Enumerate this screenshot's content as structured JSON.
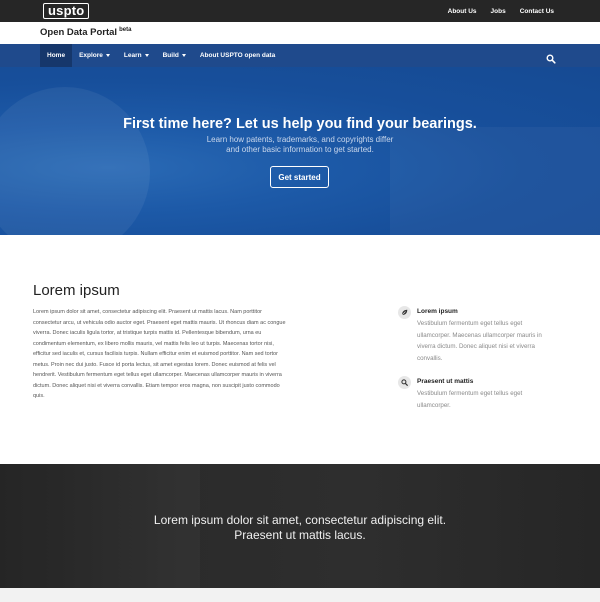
{
  "topbar": {
    "logo": "uspto",
    "links": [
      "About Us",
      "Jobs",
      "Contact Us"
    ]
  },
  "portal": {
    "title": "Open Data Portal",
    "badge": "beta"
  },
  "nav": {
    "items": [
      {
        "label": "Home",
        "dropdown": false,
        "active": true
      },
      {
        "label": "Explore",
        "dropdown": true
      },
      {
        "label": "Learn",
        "dropdown": true
      },
      {
        "label": "Build",
        "dropdown": true
      },
      {
        "label": "About USPTO open data",
        "dropdown": false
      }
    ],
    "search_icon": "search-icon"
  },
  "hero": {
    "title": "First time here? Let us help you find your bearings.",
    "subtitle_line1": "Learn how patents, trademarks, and copyrights differ",
    "subtitle_line2": "and other basic information to get started.",
    "button": "Get started"
  },
  "content": {
    "title": "Lorem ipsum",
    "body_lines": [
      "Lorem ipsum dolor sit amet, consectetur adipiscing elit. Praesent ut mattis lacus. Nam porttitor",
      "consectetur arcu, ut vehicula odio auctor eget. Praesent eget mattis mauris. Ut rhoncus diam ac congue",
      "viverra. Donec iaculis ligula tortor, at tristique turpis mattis id. Pellentesque bibendum, urna eu",
      "condimentum elementum, ex libero mollis mauris, vel mattis felis leo ut turpis. Maecenas tortor nisi,",
      "efficitur sed iaculis et, cursus facilisis turpis. Nullam efficitur enim et euismod porttitor. Nam sed tortor",
      "metus. Proin nec dui justo. Fusce id porta lectus, sit amet egestas lorem. Donec euismod at felis vel",
      "hendrerit. Vestibulum fermentum eget tellus eget ullamcorper. Maecenas ullamcorper mauris in viverra",
      "dictum. Donec aliquet nisi et viverra convallis. Etiam tempor eros magna, non suscipit justo commodo",
      "quis."
    ]
  },
  "features": [
    {
      "icon": "leaf-icon",
      "title": "Lorem ipsum",
      "desc_lines": [
        "Vestibulum fermentum eget tellus eget",
        "ullamcorper. Maecenas ullamcorper mauris in",
        "viverra dictum. Donec aliquet nisi et viverra",
        "convallis."
      ]
    },
    {
      "icon": "search-icon",
      "title": "Praesent ut mattis",
      "desc_lines": [
        "Vestibulum fermentum eget tellus eget",
        "ullamcorper."
      ]
    }
  ],
  "band": {
    "quote_line1": "Lorem ipsum dolor sit amet, consectetur adipiscing elit.",
    "quote_line2": "Praesent ut mattis lacus."
  },
  "colors": {
    "nav": "#1f4a8c",
    "hero": "#174f9b",
    "topbar": "#262626",
    "band": "#2b2b2b"
  }
}
